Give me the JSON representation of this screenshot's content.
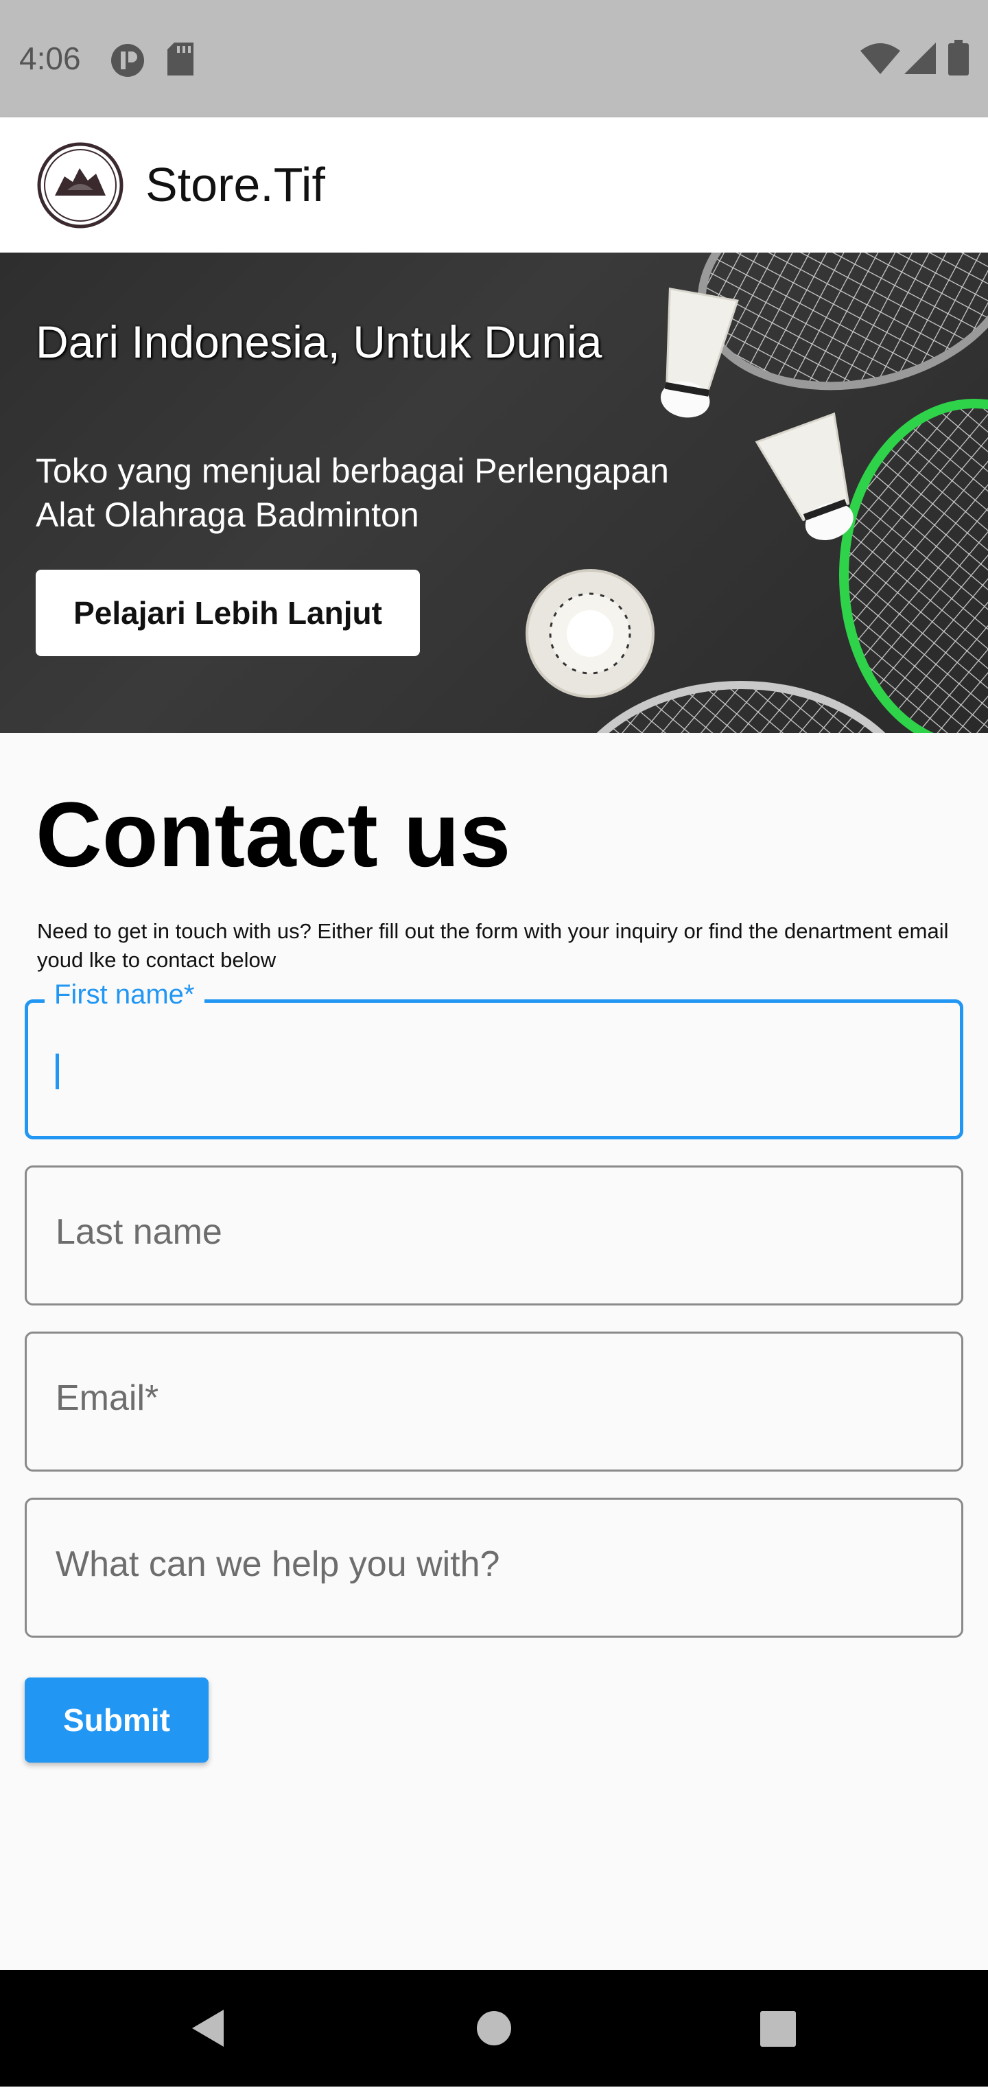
{
  "status_bar": {
    "time": "4:06",
    "icons": [
      "privacy-indicator-icon",
      "sd-card-icon",
      "wifi-icon",
      "signal-icon",
      "battery-icon"
    ]
  },
  "app_bar": {
    "title": "Store.Tif",
    "logo_text": "STORE.TIF"
  },
  "hero": {
    "title": "Dari Indonesia, Untuk Dunia",
    "subtitle": "Toko yang menjual berbagai Perlengapan Alat Olahraga Badminton",
    "button_label": "Pelajari Lebih Lanjut"
  },
  "contact": {
    "title": "Contact us",
    "description": "Need to get in touch with us? Either fill out the form with your inquiry or find the denartment email youd lke to contact below",
    "fields": {
      "first_name": {
        "label": "First name*",
        "value": ""
      },
      "last_name": {
        "label": "Last name"
      },
      "email": {
        "label": "Email*"
      },
      "message": {
        "label": "What can we help you with?"
      }
    },
    "submit_label": "Submit"
  },
  "colors": {
    "accent": "#2196f3",
    "status_bar": "#bdbdbd",
    "nav_bar": "#000000",
    "background": "#fafafa"
  }
}
